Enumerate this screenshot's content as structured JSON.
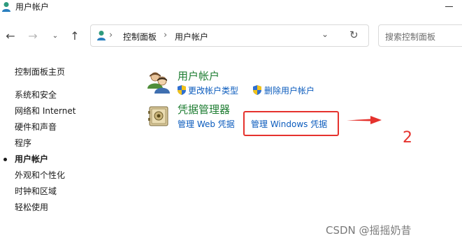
{
  "window": {
    "title": "用户帐户"
  },
  "nav": {
    "back_icon": "←",
    "forward_icon": "→",
    "recent_icon": "⌄",
    "up_icon": "↑"
  },
  "address": {
    "chevron": "›",
    "crumbs": [
      "控制面板",
      "用户帐户"
    ],
    "dropdown_icon": "⌄",
    "refresh_icon": "↻"
  },
  "search": {
    "placeholder": "搜索控制面板"
  },
  "sidebar": {
    "home": "控制面板主页",
    "items": [
      "系统和安全",
      "网络和 Internet",
      "硬件和声音",
      "程序",
      "用户帐户",
      "外观和个性化",
      "时钟和区域",
      "轻松使用"
    ],
    "active_index": 4
  },
  "main": {
    "users": {
      "heading": "用户帐户",
      "links": [
        "更改帐户类型",
        "删除用户帐户"
      ]
    },
    "credentials": {
      "heading": "凭据管理器",
      "links": [
        "管理 Web 凭据",
        "管理 Windows 凭据"
      ]
    }
  },
  "annotation": {
    "number": "2",
    "color": "#e5322d"
  },
  "watermark": "CSDN @摇摇奶昔",
  "colors": {
    "heading_green": "#1e7d32",
    "link_blue": "#0a5bbd"
  }
}
